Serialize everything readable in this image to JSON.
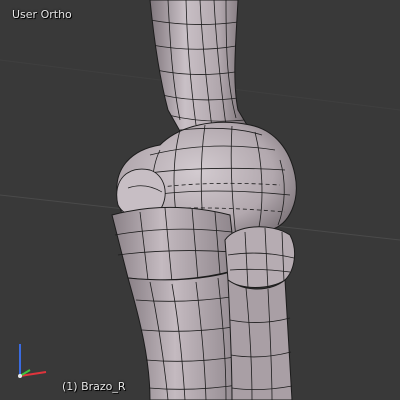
{
  "viewport": {
    "view_label": "User Ortho",
    "object_label": "(1) Brazo_R",
    "background_color": "#393939",
    "grid_line_color": "#4a4a4a"
  },
  "mesh": {
    "name": "Brazo_R",
    "fill_color": "#b7acb2",
    "wire_color": "#1c1c1c",
    "edge_highlight_color": "#ddd6da"
  },
  "axis_gizmo": {
    "x_color": "#e0343c",
    "y_color": "#3ec43e",
    "z_color": "#3a6be0"
  }
}
